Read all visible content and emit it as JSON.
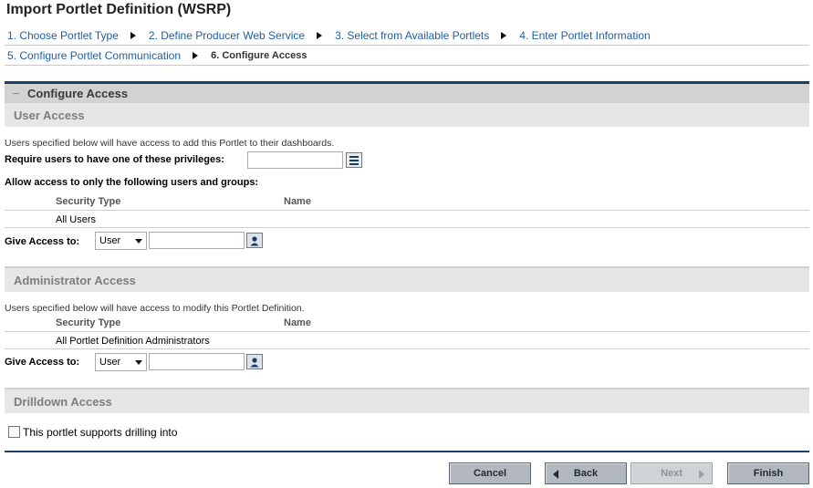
{
  "page": {
    "title": "Import Portlet Definition (WSRP)"
  },
  "wizard": {
    "steps": [
      {
        "label": "1. Choose Portlet Type"
      },
      {
        "label": "2. Define Producer Web Service"
      },
      {
        "label": "3. Select from Available Portlets"
      },
      {
        "label": "4. Enter Portlet Information"
      },
      {
        "label": "5. Configure Portlet Communication"
      },
      {
        "label": "6. Configure Access"
      }
    ]
  },
  "panel": {
    "title": "Configure Access"
  },
  "user_access": {
    "title": "User Access",
    "description": "Users specified below will have access to add this Portlet to their dashboards.",
    "privileges_label": "Require users to have one of these privileges:",
    "privileges_value": "",
    "allow_label": "Allow access to only the following users and groups:",
    "columns": [
      "Security Type",
      "Name"
    ],
    "rows": [
      {
        "security_type": "All Users",
        "name": ""
      }
    ],
    "give_access_label": "Give Access to:",
    "give_access_type": "User",
    "give_access_value": ""
  },
  "admin_access": {
    "title": "Administrator Access",
    "description": "Users specified below will have access to modify this Portlet Definition.",
    "columns": [
      "Security Type",
      "Name"
    ],
    "rows": [
      {
        "security_type": "All Portlet Definition Administrators",
        "name": ""
      }
    ],
    "give_access_label": "Give Access to:",
    "give_access_type": "User",
    "give_access_value": ""
  },
  "drilldown_access": {
    "title": "Drilldown Access",
    "checkbox_label": "This portlet supports drilling into",
    "checked": false
  },
  "buttons": {
    "cancel": "Cancel",
    "back": "Back",
    "next": "Next",
    "finish": "Finish"
  },
  "icons": {
    "collapse": "collapse-minus-icon",
    "list_picker": "list-icon",
    "user_picker": "user-picker-icon"
  },
  "colors": {
    "link": "#1e5ea8",
    "panel_accent": "#1d3f66",
    "section_header_bg": "#e6e6e6",
    "button_bg": "#b2b8bd"
  }
}
